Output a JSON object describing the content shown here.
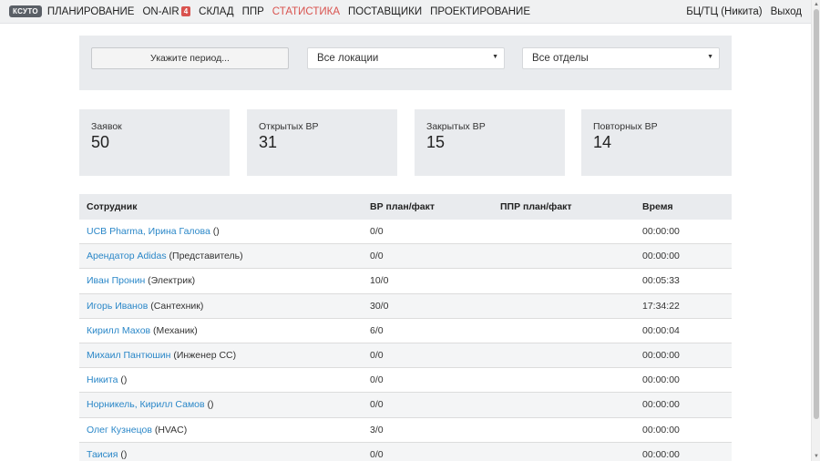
{
  "nav": {
    "brand": "КСУТО",
    "items": [
      {
        "label": "ПЛАНИРОВАНИЕ",
        "active": false
      },
      {
        "label": "ON-AIR",
        "badge": "4",
        "active": false
      },
      {
        "label": "СКЛАД",
        "active": false
      },
      {
        "label": "ППР",
        "active": false
      },
      {
        "label": "СТАТИСТИКА",
        "active": true
      },
      {
        "label": "ПОСТАВЩИКИ",
        "active": false
      },
      {
        "label": "ПРОЕКТИРОВАНИЕ",
        "active": false
      }
    ],
    "user": "БЦ/ТЦ (Никита)",
    "logout": "Выход"
  },
  "filters": {
    "period_label": "Укажите период...",
    "location_value": "Все локации",
    "department_value": "Все отделы"
  },
  "stats": [
    {
      "label": "Заявок",
      "value": "50"
    },
    {
      "label": "Открытых ВР",
      "value": "31"
    },
    {
      "label": "Закрытых ВР",
      "value": "15"
    },
    {
      "label": "Повторных ВР",
      "value": "14"
    }
  ],
  "table": {
    "headers": [
      "Сотрудник",
      "ВР план/факт",
      "ППР план/факт",
      "Время"
    ],
    "rows": [
      {
        "name": "UCB Pharma, Ирина Галова",
        "role": " ()",
        "vr": "0/0",
        "ppr": "",
        "time": "00:00:00"
      },
      {
        "name": "Арендатор Adidas",
        "role": " (Представитель)",
        "vr": "0/0",
        "ppr": "",
        "time": "00:00:00"
      },
      {
        "name": "Иван Пронин",
        "role": " (Электрик)",
        "vr": "10/0",
        "ppr": "",
        "time": "00:05:33"
      },
      {
        "name": "Игорь Иванов",
        "role": " (Сантехник)",
        "vr": "30/0",
        "ppr": "",
        "time": "17:34:22"
      },
      {
        "name": "Кирилл Махов",
        "role": " (Механик)",
        "vr": "6/0",
        "ppr": "",
        "time": "00:00:04"
      },
      {
        "name": "Михаил Пантюшин",
        "role": " (Инженер СС)",
        "vr": "0/0",
        "ppr": "",
        "time": "00:00:00"
      },
      {
        "name": "Никита",
        "role": " ()",
        "vr": "0/0",
        "ppr": "",
        "time": "00:00:00"
      },
      {
        "name": "Норникель, Кирилл Самов",
        "role": " ()",
        "vr": "0/0",
        "ppr": "",
        "time": "00:00:00"
      },
      {
        "name": "Олег Кузнецов",
        "role": " (HVAC)",
        "vr": "3/0",
        "ppr": "",
        "time": "00:00:00"
      },
      {
        "name": "Таисия",
        "role": " ()",
        "vr": "0/0",
        "ppr": "",
        "time": "00:00:00"
      }
    ]
  }
}
